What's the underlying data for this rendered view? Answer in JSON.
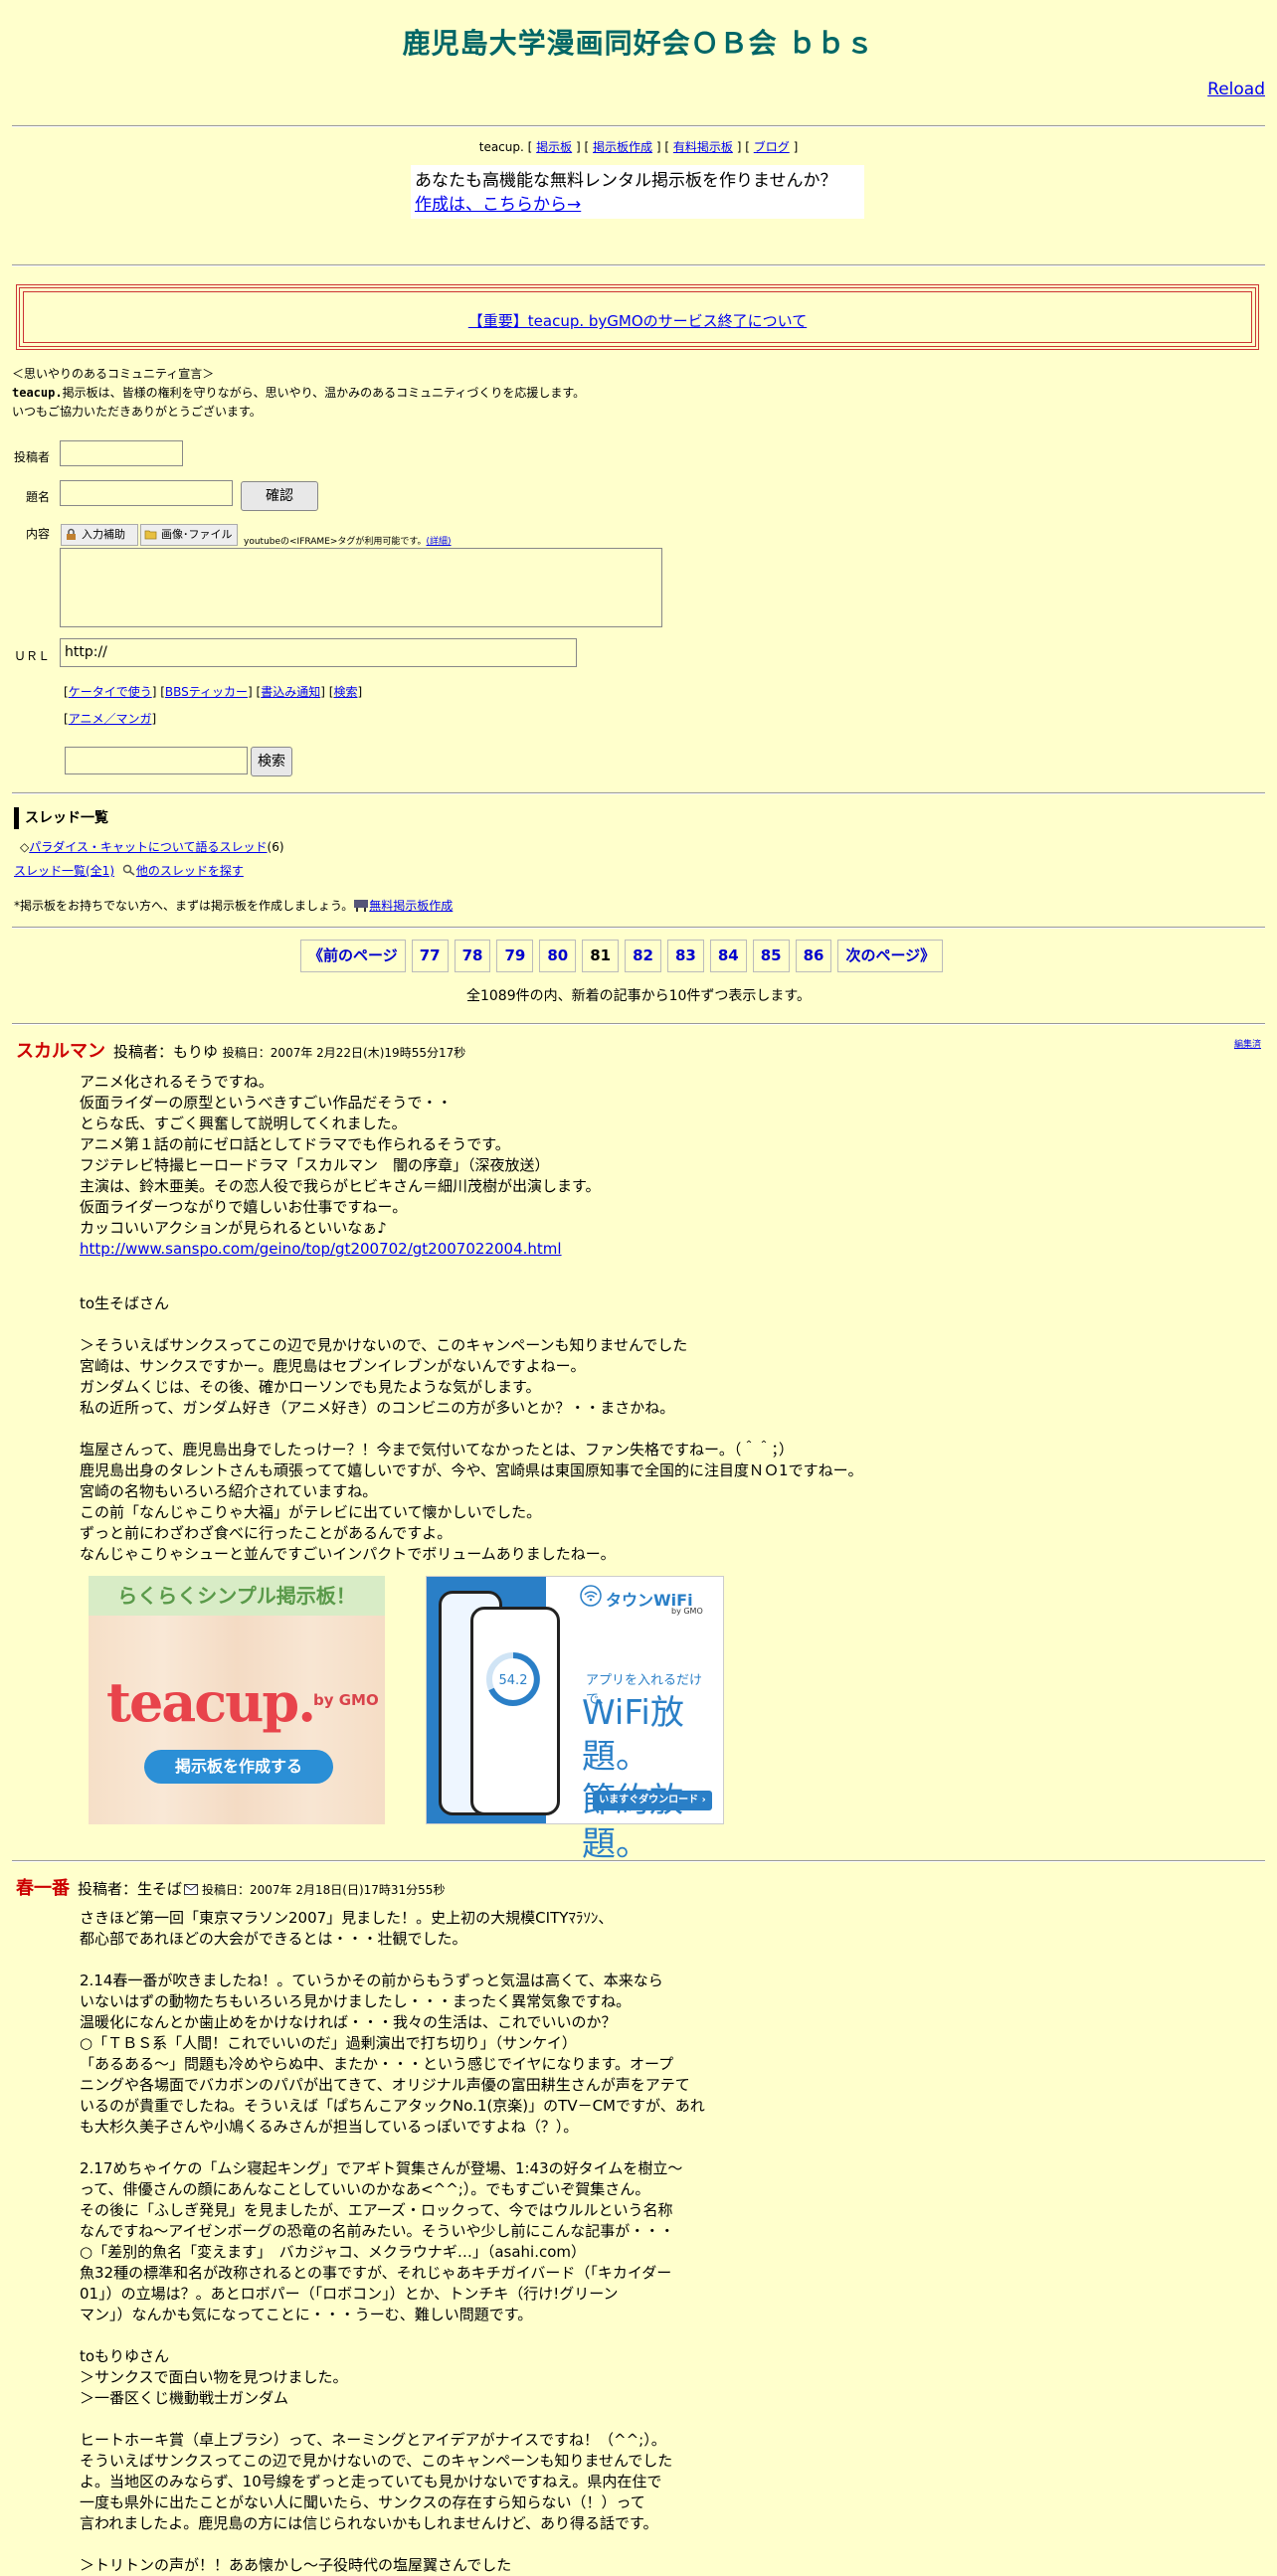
{
  "header": {
    "title": "鹿児島大学漫画同好会ＯＢ会 ｂｂｓ",
    "reload": "Reload"
  },
  "topnav": {
    "brand": "teacup.",
    "open": "[",
    "links": [
      "掲示板",
      "掲示板作成",
      "有料掲示板",
      "ブログ"
    ],
    "sep": "] [",
    "close": "]"
  },
  "promo": {
    "line1": "あなたも高機能な無料レンタル掲示板を作りませんか？",
    "link": "作成は、こちらから→"
  },
  "notice": {
    "link": "【重要】teacup. byGMOのサービス終了について"
  },
  "declaration": {
    "line1": "＜思いやりのあるコミュニティ宣言＞",
    "brand": "teacup.",
    "line2": "掲示板は、皆様の権利を守りながら、思いやり、温かみのあるコミュニティづくりを応援します。",
    "line3": "いつもご協力いただきありがとうございます。"
  },
  "form": {
    "poster_label": "投稿者",
    "subject_label": "題名",
    "confirm": "確認",
    "content_label": "内容",
    "tool_input": "入力補助",
    "tool_image": "画像･ファイル",
    "iframe_note": "youtubeの<IFRAME>タグが利用可能です。",
    "details": "(詳細)",
    "url_label": "ＵＲＬ",
    "url_value": "http://",
    "links": [
      "ケータイで使う",
      "BBSティッカー",
      "書込み通知",
      "検索"
    ],
    "links2": [
      "アニメ／マンガ"
    ],
    "search_button": "検索"
  },
  "threads": {
    "heading": "スレッド一覧",
    "item_prefix": "◇",
    "item": "パラダイス・キャットについて語るスレッド",
    "item_count": "(6)",
    "all": "スレッド一覧(全1)",
    "other": "他のスレッドを探す"
  },
  "create_note": {
    "text": "*掲示板をお持ちでない方へ、まずは掲示板を作成しましょう。",
    "link": "無料掲示板作成"
  },
  "pager": {
    "prev": "《前のページ",
    "pages": [
      "77",
      "78",
      "79",
      "80",
      "81",
      "82",
      "83",
      "84",
      "85",
      "86"
    ],
    "current": "81",
    "next": "次のページ》",
    "summary": "全1089件の内、新着の記事から10件ずつ表示します。"
  },
  "posts": [
    {
      "title": "スカルマン",
      "author": "投稿者：もりゆ",
      "date": "投稿日：2007年 2月22日(木)19時55分17秒",
      "edit": "編集済",
      "body_a": "アニメ化されるそうですね。\n仮面ライダーの原型というべきすごい作品だそうで・・\nとらな氏、すごく興奮して説明してくれました。\nアニメ第１話の前にゼロ話としてドラマでも作られるそうです。\nフジテレビ特撮ヒーロードラマ「スカルマン　闇の序章」（深夜放送）\n主演は、鈴木亜美。その恋人役で我らがヒビキさん＝細川茂樹が出演します。\n仮面ライダーつながりで嬉しいお仕事ですねー。\nカッコいいアクションが見られるといいなぁ♪",
      "link": "http://www.sanspo.com/geino/top/gt200702/gt2007022004.html",
      "body_b": "to生そばさん\n\n＞そういえばサンクスってこの辺で見かけないので、このキャンペーンも知りませんでした\n宮崎は、サンクスですかー。鹿児島はセブンイレブンがないんですよねー。\nガンダムくじは、その後、確かローソンでも見たような気がします。\n私の近所って、ガンダム好き（アニメ好き）のコンビニの方が多いとか？・・まさかね。\n\n塩屋さんって、鹿児島出身でしたっけー？！今まで気付いてなかったとは、ファン失格ですねー。（＾＾；）\n鹿児島出身のタレントさんも頑張ってて嬉しいですが、今や、宮崎県は東国原知事で全国的に注目度ＮＯ1ですねー。\n宮崎の名物もいろいろ紹介されていますね。\nこの前「なんじゃこりゃ大福」がテレビに出ていて懐かしいでした。\nずっと前にわざわざ食べに行ったことがあるんですよ。\nなんじゃこりゃシューと並んですごいインパクトでボリュームありましたねー。"
    },
    {
      "title": "春一番",
      "author": "投稿者：生そば",
      "date": "投稿日：2007年 2月18日(日)17時31分55秒",
      "body": "さきほど第一回「東京マラソン2007」見ました！。史上初の大規模CITYﾏﾗｿﾝ、\n都心部であれほどの大会ができるとは・・・壮観でした。\n\n2.14春一番が吹きましたね！。ていうかその前からもうずっと気温は高くて、本来なら\nいないはずの動物たちもいろいろ見かけましたし・・・まったく異常気象ですね。\n温暖化になんとか歯止めをかけなければ・・・我々の生活は、これでいいのか？\n○「ＴＢＳ系「人間！これでいいのだ」過剰演出で打ち切り」（サンケイ）\n「あるある～」問題も冷めやらぬ中、またか・・・という感じでイヤになります。オープ\nニングや各場面でバカボンのパパが出てきて、オリジナル声優の富田耕生さんが声をアテて\nいるのが貴重でしたね。そういえば「ぱちんこアタックNo.1(京楽)」のTV－CMですが、あれ\nも大杉久美子さんや小鳩くるみさんが担当しているっぽいですよね（？）。\n\n2.17めちゃイケの「ムシ寝起キング」でアギト賀集さんが登場、1:43の好タイムを樹立～\nって、俳優さんの顔にあんなことしていいのかなあ<^^;）。でもすごいぞ賀集さん。\nその後に「ふしぎ発見」を見ましたが、エアーズ・ロックって、今ではウルルという名称\nなんですね～アイゼンボーグの恐竜の名前みたい。そういや少し前にこんな記事が・・・\n○「差別的魚名「変えます」　バカジャコ、メクラウナギ…」（asahi.com）\n魚32種の標準和名が改称されるとの事ですが、それじゃあキチガイバード（「キカイダー\n01」）の立場は？。あとロボパー（「ロボコン」）とか、トンチキ（行け!グリーン\nマン」）なんかも気になってことに・・・うーむ、難しい問題です。\n\ntoもりゆさん\n＞サンクスで面白い物を見つけました。\n＞一番区くじ機動戦士ガンダム\n\nヒートホーキ賞（卓上ブラシ）って、ネーミングとアイデアがナイスですね！（^^;）。\nそういえばサンクスってこの辺で見かけないので、このキャンペーンも知りませんでした\nよ。当地区のみならず、10号線をずっと走っていても見かけないですねえ。県内在住で\n一度も県外に出たことがない人に聞いたら、サンクスの存在すら知らない（！）って\n言われましたよ。鹿児島の方には信じられないかもしれませんけど、あり得る話です。\n\n＞トリトンの声が！！ああ懐かし～子役時代の塩屋翼さんでした"
    }
  ],
  "ads": {
    "teacup": {
      "header": "らくらくシンプル掲示板！",
      "logo": "teacup.",
      "by": "by GMO",
      "cta": "掲示板を作成する"
    },
    "wifi": {
      "brand": "タウンWiFi",
      "brand_by": "by GMO",
      "sub": "アプリを入れるだけで、",
      "big1": "WiFi放題。",
      "big2": "節約放題。",
      "dl": "いますぐダウンロード ›",
      "speed": "54.2"
    }
  },
  "colors": {
    "background": "#ffffcc",
    "title": "#006666",
    "post_title": "#cc0000",
    "link": "#0000ee",
    "notice_border": "#cc3333"
  }
}
